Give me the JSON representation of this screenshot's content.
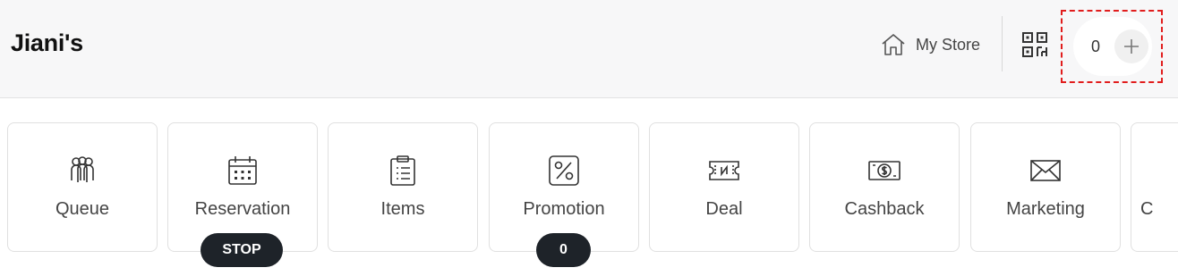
{
  "header": {
    "brand": "Jiani's",
    "my_store_label": "My Store",
    "my_store_icon": "home-icon",
    "qr_icon": "qr-code-icon",
    "counter_value": "0",
    "add_icon": "plus-icon",
    "highlight_color": "#e11d1d"
  },
  "tiles": [
    {
      "label": "Queue",
      "icon": "queue-people-icon"
    },
    {
      "label": "Reservation",
      "icon": "calendar-icon",
      "badge": "STOP"
    },
    {
      "label": "Items",
      "icon": "clipboard-list-icon"
    },
    {
      "label": "Promotion",
      "icon": "percent-icon",
      "badge": "0"
    },
    {
      "label": "Deal",
      "icon": "ticket-icon"
    },
    {
      "label": "Cashback",
      "icon": "banknote-dollar-icon"
    },
    {
      "label": "Marketing",
      "icon": "envelope-icon"
    },
    {
      "label": "C"
    }
  ],
  "colors": {
    "badge_bg": "#1e2329",
    "header_bg": "#f7f7f8"
  }
}
